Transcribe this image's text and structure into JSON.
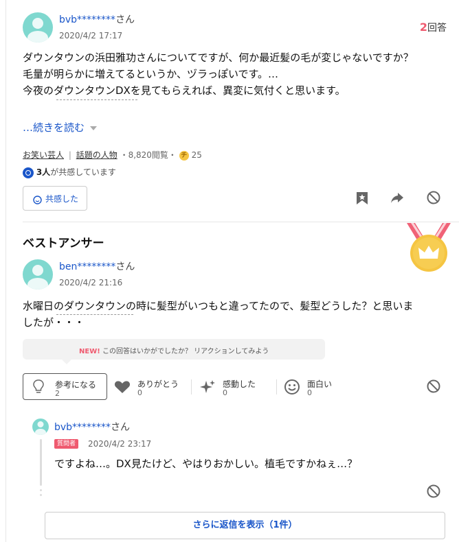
{
  "question": {
    "user": "bvb********",
    "user_suffix": "さん",
    "date": "2020/4/2 17:17",
    "answer_count_num": "2",
    "answer_count_suffix": "回答",
    "lines": [
      "ダウンタウンの浜田雅功さんについてですが、何か最近髪の毛が変じゃないですか？",
      "毛量が明らかに増えてるというか、ヅラっぽいです。…",
      "今夜のダウンタウンDXを見てもらえれば、異変に気付くと思います。"
    ],
    "read_more": "…続きを読む",
    "categories": [
      "お笑い芸人",
      "話題の人物"
    ],
    "category_sep": "|",
    "views": "・8,820閲覧・",
    "coin_label": "チ",
    "coins": "25",
    "empathy_count": "3人",
    "empathy_text": "が共感しています",
    "empathy_button": "共感した"
  },
  "best_answer": {
    "heading": "ベストアンサー",
    "user": "ben********",
    "user_suffix": "さん",
    "date": "2020/4/2 21:16",
    "line1": "水曜日のダウンタウンの時に髪型がいつもと違ってたので、髪型どうした？と思いま",
    "line2": "したが・・・",
    "prompt_new": "NEW!",
    "prompt_text": "この回答はいかがでしたか？ リアクションしてみよう",
    "reactions": [
      {
        "label": "参考になる",
        "count": "2",
        "icon": "lightbulb-icon"
      },
      {
        "label": "ありがとう",
        "count": "0",
        "icon": "heart-icon"
      },
      {
        "label": "感動した",
        "count": "0",
        "icon": "sparkle-icon"
      },
      {
        "label": "面白い",
        "count": "0",
        "icon": "smile-icon"
      }
    ]
  },
  "reply": {
    "user": "bvb********",
    "user_suffix": "さん",
    "badge": "質問者",
    "date": "2020/4/2 23:17",
    "text": "ですよね…。DX見たけど、やはりおかしい。植毛ですかねぇ…？",
    "more_button": "さらに返信を表示（1件）"
  },
  "colors": {
    "accent_blue": "#1a56c9",
    "answer_count_red": "#ef5a6f",
    "medal_gold": "#f5c542",
    "ribbon": "#f06277",
    "avatar": "#7fd8cf"
  }
}
